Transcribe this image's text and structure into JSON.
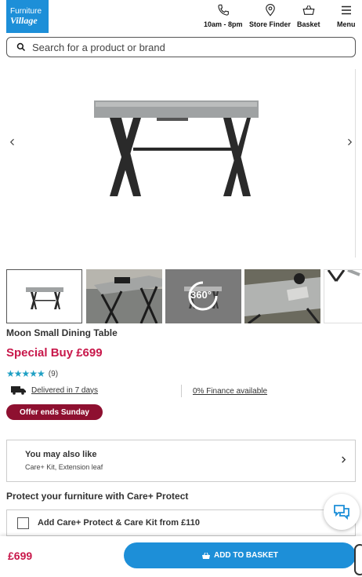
{
  "header": {
    "logo_line1": "Furniture",
    "logo_line2": "Village",
    "hours_label": "10am - 8pm",
    "store_finder_label": "Store Finder",
    "basket_label": "Basket",
    "menu_label": "Menu",
    "icons": [
      "phone-icon",
      "location-pin-icon",
      "basket-icon",
      "menu-icon"
    ]
  },
  "search": {
    "placeholder": "Search for a product or brand"
  },
  "product": {
    "title": "Moon Small Dining Table",
    "price_label": "Special Buy £699",
    "rating_stars": 5,
    "review_count": "(9)",
    "delivery_text": "Delivered in 7 days",
    "finance_text": "0% Finance available",
    "offer_badge": "Offer ends Sunday"
  },
  "gallery": {
    "thumbnails": [
      "front-view",
      "room-view",
      "360-view",
      "detail-view",
      "angle-view"
    ],
    "badge_360": "360°"
  },
  "also_like": {
    "title": "You may also like",
    "subtitle": "Care+ Kit, Extension leaf"
  },
  "protect": {
    "title": "Protect your furniture with Care+ Protect",
    "option_label": "Add Care+ Protect & Care Kit from £110"
  },
  "footer": {
    "price": "£699",
    "add_label": "ADD TO BASKET"
  },
  "colors": {
    "brand_blue": "#1d8fd8",
    "price_red": "#c8174a",
    "offer_bg": "#8e1030",
    "star": "#1fa0c4"
  }
}
